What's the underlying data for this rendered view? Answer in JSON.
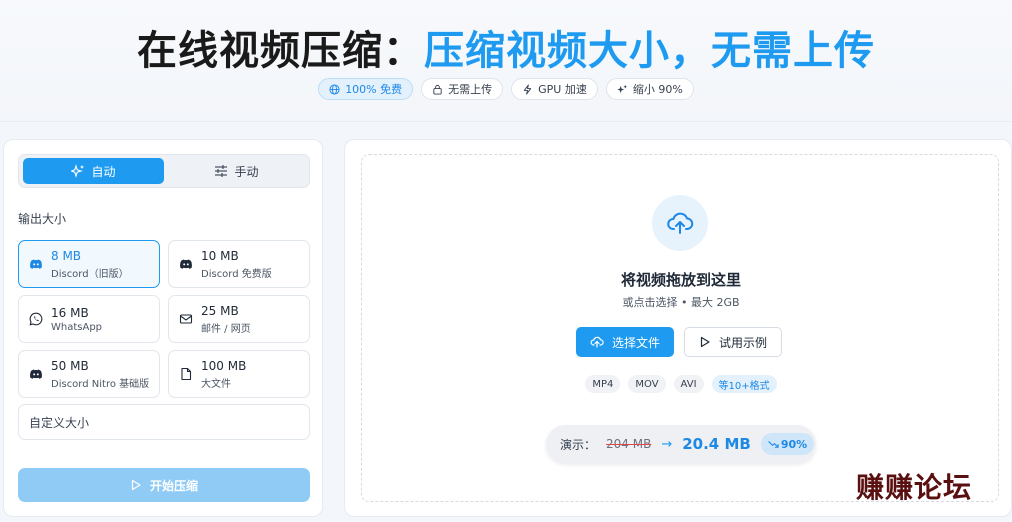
{
  "hero": {
    "title_a": "在线视频压缩：",
    "title_b": "压缩视频大小，无需上传",
    "badges": [
      {
        "icon": "globe-icon",
        "label": "100% 免费"
      },
      {
        "icon": "lock-icon",
        "label": "无需上传"
      },
      {
        "icon": "bolt-icon",
        "label": "GPU 加速"
      },
      {
        "icon": "sparkle-icon",
        "label": "缩小 90%"
      }
    ]
  },
  "left": {
    "mode_auto": "自动",
    "mode_manual": "手动",
    "output_size_label": "输出大小",
    "sizes": [
      {
        "size": "8 MB",
        "sub": "Discord（旧版）",
        "icon": "discord-icon",
        "selected": true
      },
      {
        "size": "10 MB",
        "sub": "Discord 免费版",
        "icon": "discord-icon"
      },
      {
        "size": "16 MB",
        "sub": "WhatsApp",
        "icon": "whatsapp-icon"
      },
      {
        "size": "25 MB",
        "sub": "邮件 / 网页",
        "icon": "mail-icon"
      },
      {
        "size": "50 MB",
        "sub": "Discord Nitro 基础版",
        "icon": "discord-icon"
      },
      {
        "size": "100 MB",
        "sub": "大文件",
        "icon": "file-icon"
      }
    ],
    "custom_size_label": "自定义大小",
    "start_button": "开始压缩"
  },
  "right": {
    "drop_title": "将视频拖放到这里",
    "drop_sub": "或点击选择 • 最大 2GB",
    "select_button": "选择文件",
    "demo_button": "试用示例",
    "formats": [
      "MP4",
      "MOV",
      "AVI",
      "等10+格式"
    ],
    "demo": {
      "label": "演示：",
      "old": "204 MB",
      "new": "20.4 MB",
      "pct": "90%"
    }
  },
  "watermark": "赚赚论坛",
  "colors": {
    "accent": "#1e9bf0",
    "watermark": "#5a1010"
  }
}
